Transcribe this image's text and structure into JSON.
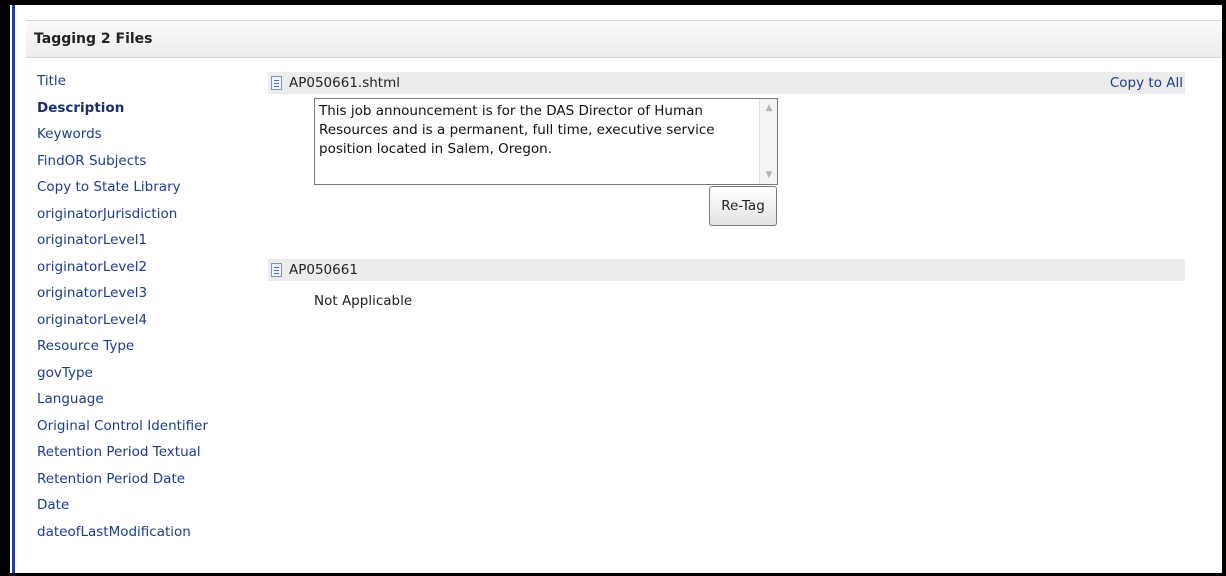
{
  "header": {
    "title": "Tagging 2 Files"
  },
  "sidebar": {
    "items": [
      {
        "label": "Title"
      },
      {
        "label": "Description",
        "active": true
      },
      {
        "label": "Keywords"
      },
      {
        "label": "FindOR Subjects"
      },
      {
        "label": "Copy to State Library"
      },
      {
        "label": "originatorJurisdiction"
      },
      {
        "label": "originatorLevel1"
      },
      {
        "label": "originatorLevel2"
      },
      {
        "label": "originatorLevel3"
      },
      {
        "label": "originatorLevel4"
      },
      {
        "label": "Resource Type"
      },
      {
        "label": "govType"
      },
      {
        "label": "Language"
      },
      {
        "label": "Original Control Identifier"
      },
      {
        "label": "Retention Period Textual"
      },
      {
        "label": "Retention Period Date"
      },
      {
        "label": "Date"
      },
      {
        "label": "dateofLastModification"
      }
    ]
  },
  "files": [
    {
      "name": "AP050661.shtml",
      "icon": "document-icon",
      "copy_to_all_label": "Copy to All",
      "description_value": "This job announcement is for the DAS Director of Human Resources and is a permanent, full time, executive service position located in Salem, Oregon.",
      "retag_label": "Re-Tag"
    },
    {
      "name": "AP050661",
      "icon": "document-icon",
      "value": "Not Applicable"
    }
  ],
  "colors": {
    "link": "#1d3c8f",
    "frame": "#000000",
    "accent_stripe": "#1f3fa8",
    "bar": "#ececec"
  }
}
